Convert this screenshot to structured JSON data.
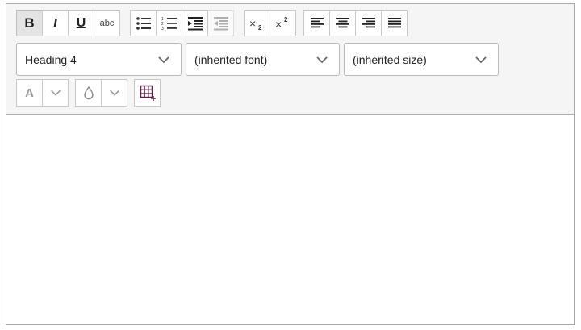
{
  "toolbar": {
    "format_buttons": [
      {
        "label": "B",
        "name": "bold"
      },
      {
        "label": "I",
        "name": "italic"
      },
      {
        "label": "U",
        "name": "underline"
      },
      {
        "label": "abc",
        "name": "strikethrough"
      }
    ],
    "block_select": {
      "value": "Heading 4"
    },
    "font_select": {
      "value": "(inherited font)"
    },
    "size_select": {
      "value": "(inherited size)"
    },
    "text_color_label": "A",
    "icons": {
      "bullet_list": "bullet-list-icon",
      "numbered_list": "numbered-list-icon",
      "indent": "indent-icon",
      "outdent": "outdent-icon",
      "subscript": "subscript-icon",
      "superscript": "superscript-icon",
      "align_left": "align-left-icon",
      "align_center": "align-center-icon",
      "align_right": "align-right-icon",
      "justify": "justify-icon",
      "text_color": "text-color-icon",
      "background_color": "background-color-icon",
      "insert_table": "table-insert-icon"
    }
  },
  "colors": {
    "toolbar_bg": "#f5f5f5",
    "border": "#a9a9a9",
    "table_icon": "#5c1f4a"
  }
}
